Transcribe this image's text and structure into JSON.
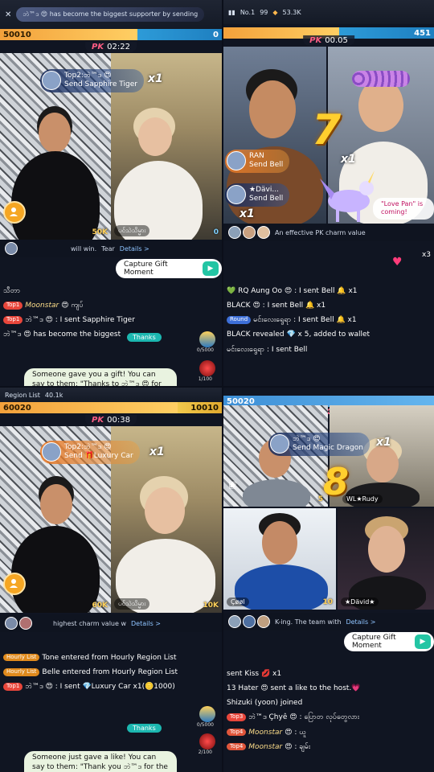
{
  "q1": {
    "banner": "ဘဲ™ဒ 😍 has become the biggest supporter by sending",
    "score_left": "50010",
    "score_right": "0",
    "timer_label": "PK",
    "timer": "02:22",
    "gift_user": "Top2:ဘဲ™ဒ 😍",
    "gift_text": "Send Sapphire Tiger",
    "gift_count": "x1",
    "left_score": "50K",
    "right_name": "ပင်သဲသိမ္မား",
    "right_score": "0",
    "mid_text": "will win.",
    "mid_tear": "Tear",
    "details": "Details >",
    "capture": "Capture Gift Moment",
    "chat": [
      {
        "badge": "",
        "text": "သီတာ"
      },
      {
        "badge": "Top1",
        "name": "Moonstar",
        "text": "😍 ကျပ်"
      },
      {
        "badge": "Top1",
        "name": "ဘဲ™ဒ",
        "text": "😍 : I sent Sapphire Tiger"
      },
      {
        "badge": "",
        "text": "ဘဲ™ဒ 😍 has become the biggest"
      }
    ],
    "thanks": "Thanks",
    "sys_msg": "Someone gave you a gift! You can say to them: \"Thanks to ဘဲ™ဒ 😍 for giving me",
    "side1_lbl": "0/5000",
    "side2_lbl": "1/100"
  },
  "q2": {
    "top_rank": "No.1",
    "top_count": "99",
    "top_diamonds": "53.3K",
    "score_left": "",
    "score_right": "451",
    "timer_label": "PK",
    "timer": "00.05",
    "effect_number": "7",
    "effect_count": "x1",
    "gift1_user": "RAN",
    "gift1_text": "Send Bell",
    "gift2_user": "★Dävi...",
    "gift2_text": "Send Bell",
    "x1_left": "x1",
    "pet_text": "\"Love Pan\" is coming!",
    "mid_text": "An effective PK charm value",
    "multiplier": "x3",
    "chat": [
      {
        "text": "💚 RQ Aung Oo 😍 : I sent Bell 🔔 x1"
      },
      {
        "text": "BLACK 😍 : I sent Bell 🔔 x1"
      },
      {
        "badge": "Round",
        "text": "မင်းလေးရွေရာ : I sent Bell 🔔 x1"
      },
      {
        "text": "BLACK revealed 💎 x 5, added to wallet"
      },
      {
        "text": "မင်းလေးရွေရာ : I sent Bell"
      }
    ]
  },
  "q3": {
    "region_text": "Region List",
    "region_count": "40.1k",
    "score_left": "60020",
    "score_right": "10010",
    "timer_label": "PK",
    "timer": "00:38",
    "gift_user": "Top2:ဘဲ™ဒ 😍",
    "gift_text": "Send 🎁Luxury Car",
    "gift_count": "x1",
    "left_score": "60K",
    "right_name": "ပင်သဲသိမ္မား",
    "right_score": "10K",
    "mid_text": "highest charm value w",
    "details": "Details >",
    "chat": [
      {
        "badge": "Hourly List",
        "text": "Tone entered from Hourly Region List"
      },
      {
        "badge": "Hourly List",
        "text": "Belle entered from Hourly Region List"
      },
      {
        "badge": "Top1",
        "text": "ဘဲ™ဒ 😍 : I sent 💎Luxury Car x1(🪙1000)"
      }
    ],
    "thanks": "Thanks",
    "sys_msg": "Someone just gave a like! You can say to them: \"Thank you ဘဲ™ဒ for the like!",
    "side1_lbl": "0/5000",
    "side2_lbl": "2/100"
  },
  "q4": {
    "score_left": "50020",
    "timer_label": "PK",
    "timer": "8",
    "gift_user": "ဘဲ™ဒ 😍",
    "gift_text": "Send Magic Dragon",
    "gift_count": "x1",
    "effect_number": "8",
    "tl_score": "5",
    "tr_name": "WL★Rudy",
    "bl_name": "Çøøl",
    "bl_score": "10",
    "br_name": "★Dävid★",
    "mid_text": "K-ing. The team with",
    "details": "Details >",
    "capture": "Capture Gift Moment",
    "chat": [
      {
        "text": "sent Kiss 💋 x1"
      },
      {
        "text": "13 Hater 😍 sent a like to the host.💗"
      },
      {
        "text": "Shizuki (yoon) joined"
      },
      {
        "badge": "Top3",
        "text": "ဘဲ™ဒ Çhyê 😍 : ပြောတ လုပ်တွေလား"
      },
      {
        "badge": "Top4",
        "name": "Moonstar",
        "text": "😍 : ယူ"
      },
      {
        "badge": "Top4",
        "name": "Moonstar",
        "text": "😍 : ချမ်း"
      }
    ]
  }
}
